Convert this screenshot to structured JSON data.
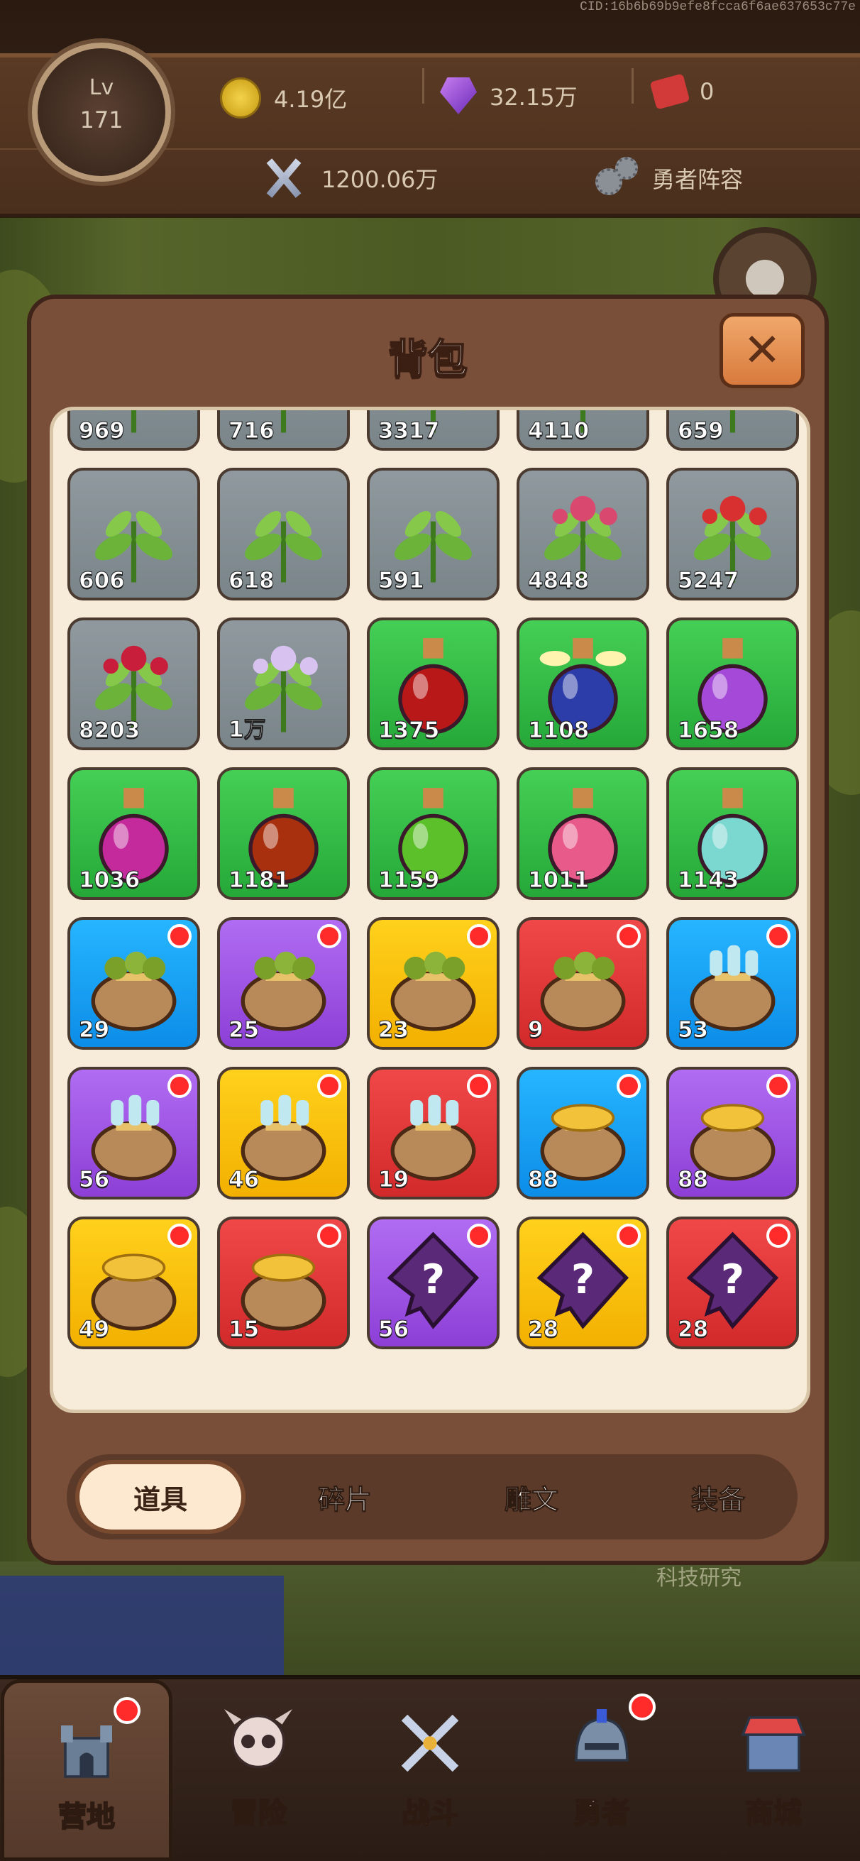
{
  "watermark": "CID:16b6b69b9efe8fcca6f6ae637653c77e",
  "hud": {
    "level_prefix": "Lv",
    "level": "171",
    "gold": "4.19亿",
    "gems": "32.15万",
    "tickets": "0",
    "power": "1200.06万",
    "team_label": "勇者阵容"
  },
  "background": {
    "hint_text": "科技研究"
  },
  "backpack": {
    "title": "背包",
    "close_label": "✕",
    "items": [
      {
        "count": "969",
        "bg": "gray",
        "icon": "herb-grass-icon",
        "dot": false
      },
      {
        "count": "716",
        "bg": "gray",
        "icon": "herb-sprout-icon",
        "dot": false
      },
      {
        "count": "3317",
        "bg": "gray",
        "icon": "herb-leaf-icon",
        "dot": false
      },
      {
        "count": "4110",
        "bg": "gray",
        "icon": "herb-bush-icon",
        "dot": false
      },
      {
        "count": "659",
        "bg": "gray",
        "icon": "herb-flower-icon",
        "dot": false
      },
      {
        "count": "606",
        "bg": "gray",
        "icon": "herb-stem-icon",
        "dot": false
      },
      {
        "count": "618",
        "bg": "gray",
        "icon": "herb-cabbage-icon",
        "dot": false
      },
      {
        "count": "591",
        "bg": "gray",
        "icon": "herb-fern-icon",
        "dot": false
      },
      {
        "count": "4848",
        "bg": "gray",
        "icon": "herb-clover-flower-icon",
        "dot": false
      },
      {
        "count": "5247",
        "bg": "gray",
        "icon": "herb-berry-icon",
        "dot": false
      },
      {
        "count": "8203",
        "bg": "gray",
        "icon": "herb-raspberry-icon",
        "dot": false
      },
      {
        "count": "1万",
        "bg": "gray",
        "icon": "herb-lily-icon",
        "dot": false
      },
      {
        "count": "1375",
        "bg": "green",
        "icon": "red-potion-icon",
        "dot": false
      },
      {
        "count": "1108",
        "bg": "green",
        "icon": "blue-winged-potion-icon",
        "dot": false
      },
      {
        "count": "1658",
        "bg": "green",
        "icon": "purple-bottle-potion-icon",
        "dot": false
      },
      {
        "count": "1036",
        "bg": "green",
        "icon": "pink-potion-icon",
        "dot": false
      },
      {
        "count": "1181",
        "bg": "green",
        "icon": "amber-potion-icon",
        "dot": false
      },
      {
        "count": "1159",
        "bg": "green",
        "icon": "green-potion-icon",
        "dot": false
      },
      {
        "count": "1011",
        "bg": "green",
        "icon": "flask-potion-icon",
        "dot": false
      },
      {
        "count": "1143",
        "bg": "green",
        "icon": "teal-bottle-potion-icon",
        "dot": false
      },
      {
        "count": "29",
        "bg": "blue",
        "icon": "seed-bag-icon",
        "dot": true
      },
      {
        "count": "25",
        "bg": "purple",
        "icon": "seed-bag-icon",
        "dot": true
      },
      {
        "count": "23",
        "bg": "gold",
        "icon": "seed-bag-icon",
        "dot": true
      },
      {
        "count": "9",
        "bg": "red",
        "icon": "seed-bag-icon",
        "dot": true
      },
      {
        "count": "53",
        "bg": "blue",
        "icon": "potion-bag-icon",
        "dot": true
      },
      {
        "count": "56",
        "bg": "purple",
        "icon": "potion-bag-icon",
        "dot": true
      },
      {
        "count": "46",
        "bg": "gold",
        "icon": "potion-bag-icon",
        "dot": true
      },
      {
        "count": "19",
        "bg": "red",
        "icon": "potion-bag-icon",
        "dot": true
      },
      {
        "count": "88",
        "bg": "blue",
        "icon": "gold-bag-icon",
        "dot": true
      },
      {
        "count": "88",
        "bg": "purple",
        "icon": "gold-bag-icon",
        "dot": true
      },
      {
        "count": "49",
        "bg": "gold",
        "icon": "gold-bag-icon",
        "dot": true
      },
      {
        "count": "15",
        "bg": "red",
        "icon": "gold-bag-icon",
        "dot": true
      },
      {
        "count": "56",
        "bg": "purple",
        "icon": "mystery-rune-icon",
        "dot": true
      },
      {
        "count": "28",
        "bg": "gold",
        "icon": "mystery-rune-icon",
        "dot": true
      },
      {
        "count": "28",
        "bg": "red",
        "icon": "mystery-rune-icon",
        "dot": true
      }
    ],
    "tabs": [
      {
        "label": "道具",
        "active": true
      },
      {
        "label": "碎片",
        "active": false
      },
      {
        "label": "雕文",
        "active": false
      },
      {
        "label": "装备",
        "active": false
      }
    ]
  },
  "nav": [
    {
      "label": "营地",
      "active": true,
      "icon": "castle-icon",
      "dot": true
    },
    {
      "label": "冒险",
      "active": false,
      "icon": "skull-icon",
      "dot": false
    },
    {
      "label": "战斗",
      "active": false,
      "icon": "swords-icon",
      "dot": false
    },
    {
      "label": "勇者",
      "active": false,
      "icon": "helmet-icon",
      "dot": true
    },
    {
      "label": "商城",
      "active": false,
      "icon": "shop-icon",
      "dot": false
    }
  ]
}
